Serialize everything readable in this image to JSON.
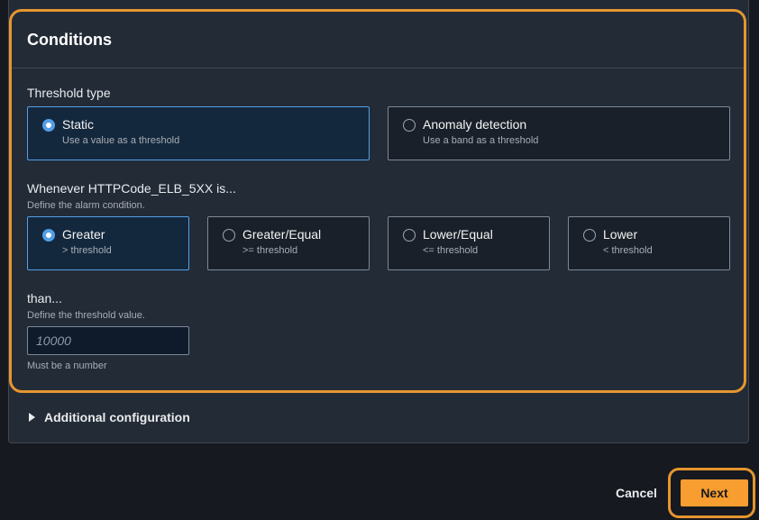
{
  "conditions": {
    "title": "Conditions",
    "threshold_type": {
      "label": "Threshold type",
      "options": [
        {
          "title": "Static",
          "sub": "Use a value as a threshold",
          "selected": true
        },
        {
          "title": "Anomaly detection",
          "sub": "Use a band as a threshold",
          "selected": false
        }
      ]
    },
    "whenever": {
      "label": "Whenever HTTPCode_ELB_5XX is...",
      "desc": "Define the alarm condition.",
      "options": [
        {
          "title": "Greater",
          "sub": "> threshold",
          "selected": true
        },
        {
          "title": "Greater/Equal",
          "sub": ">= threshold",
          "selected": false
        },
        {
          "title": "Lower/Equal",
          "sub": "<= threshold",
          "selected": false
        },
        {
          "title": "Lower",
          "sub": "< threshold",
          "selected": false
        }
      ]
    },
    "than": {
      "label": "than...",
      "desc": "Define the threshold value.",
      "placeholder": "10000",
      "value": "",
      "hint": "Must be a number"
    }
  },
  "additional": {
    "label": "Additional configuration"
  },
  "footer": {
    "cancel_label": "Cancel",
    "next_label": "Next"
  },
  "colors": {
    "accent": "#539fe5",
    "highlight": "#e6962f",
    "primary_button": "#f89d2f"
  }
}
